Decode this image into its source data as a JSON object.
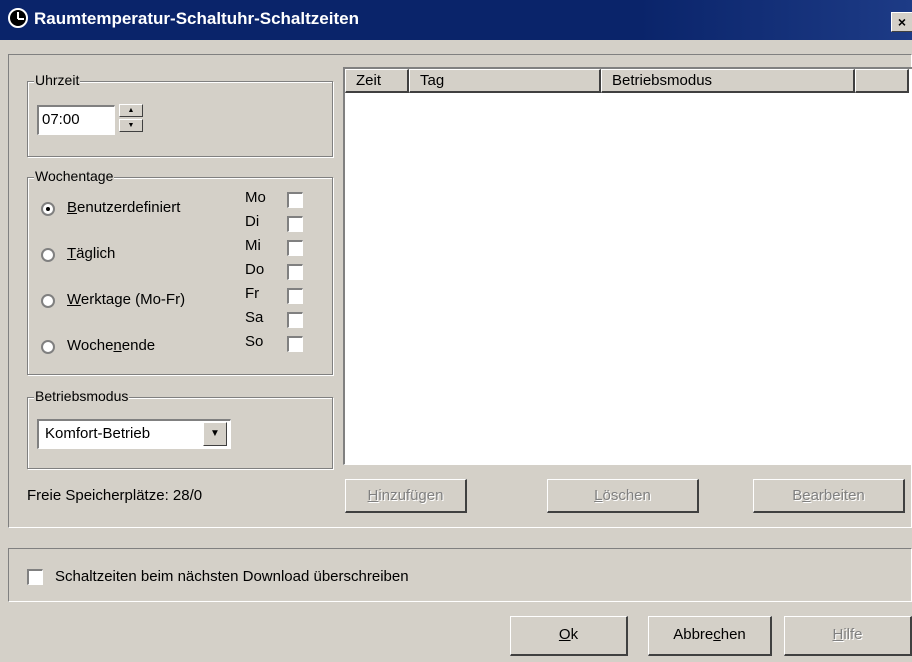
{
  "window": {
    "title": "Raumtemperatur-Schaltuhr-Schaltzeiten",
    "close": "×"
  },
  "uhrzeit": {
    "legend": "Uhrzeit",
    "value": "07:00"
  },
  "wochentage": {
    "legend": "Wochentage",
    "radios": [
      {
        "pre": "",
        "key": "B",
        "post": "enutzerdefiniert",
        "checked": true
      },
      {
        "pre": "",
        "key": "T",
        "post": "äglich",
        "checked": false
      },
      {
        "pre": "",
        "key": "W",
        "post": "erktage (Mo-Fr)",
        "checked": false
      },
      {
        "pre": "Woche",
        "key": "n",
        "post": "ende",
        "checked": false
      }
    ],
    "days": [
      "Mo",
      "Di",
      "Mi",
      "Do",
      "Fr",
      "Sa",
      "So"
    ]
  },
  "betriebsmodus": {
    "legend": "Betriebsmodus",
    "value": "Komfort-Betrieb"
  },
  "memory": "Freie Speicherplätze: 28/0",
  "list": {
    "columns": [
      "Zeit",
      "Tag",
      "Betriebsmodus",
      ""
    ]
  },
  "actions": {
    "add": {
      "key": "H",
      "post": "inzufügen"
    },
    "delete": {
      "key": "L",
      "post": "öschen"
    },
    "edit": {
      "pre": "B",
      "key": "e",
      "post": "arbeiten"
    }
  },
  "overwrite_label": "Schaltzeiten beim nächsten Download überschreiben",
  "footer": {
    "ok": {
      "key": "O",
      "post": "k"
    },
    "cancel": {
      "pre": "Abbre",
      "key": "c",
      "post": "hen"
    },
    "help": {
      "key": "H",
      "post": "ilfe"
    }
  }
}
